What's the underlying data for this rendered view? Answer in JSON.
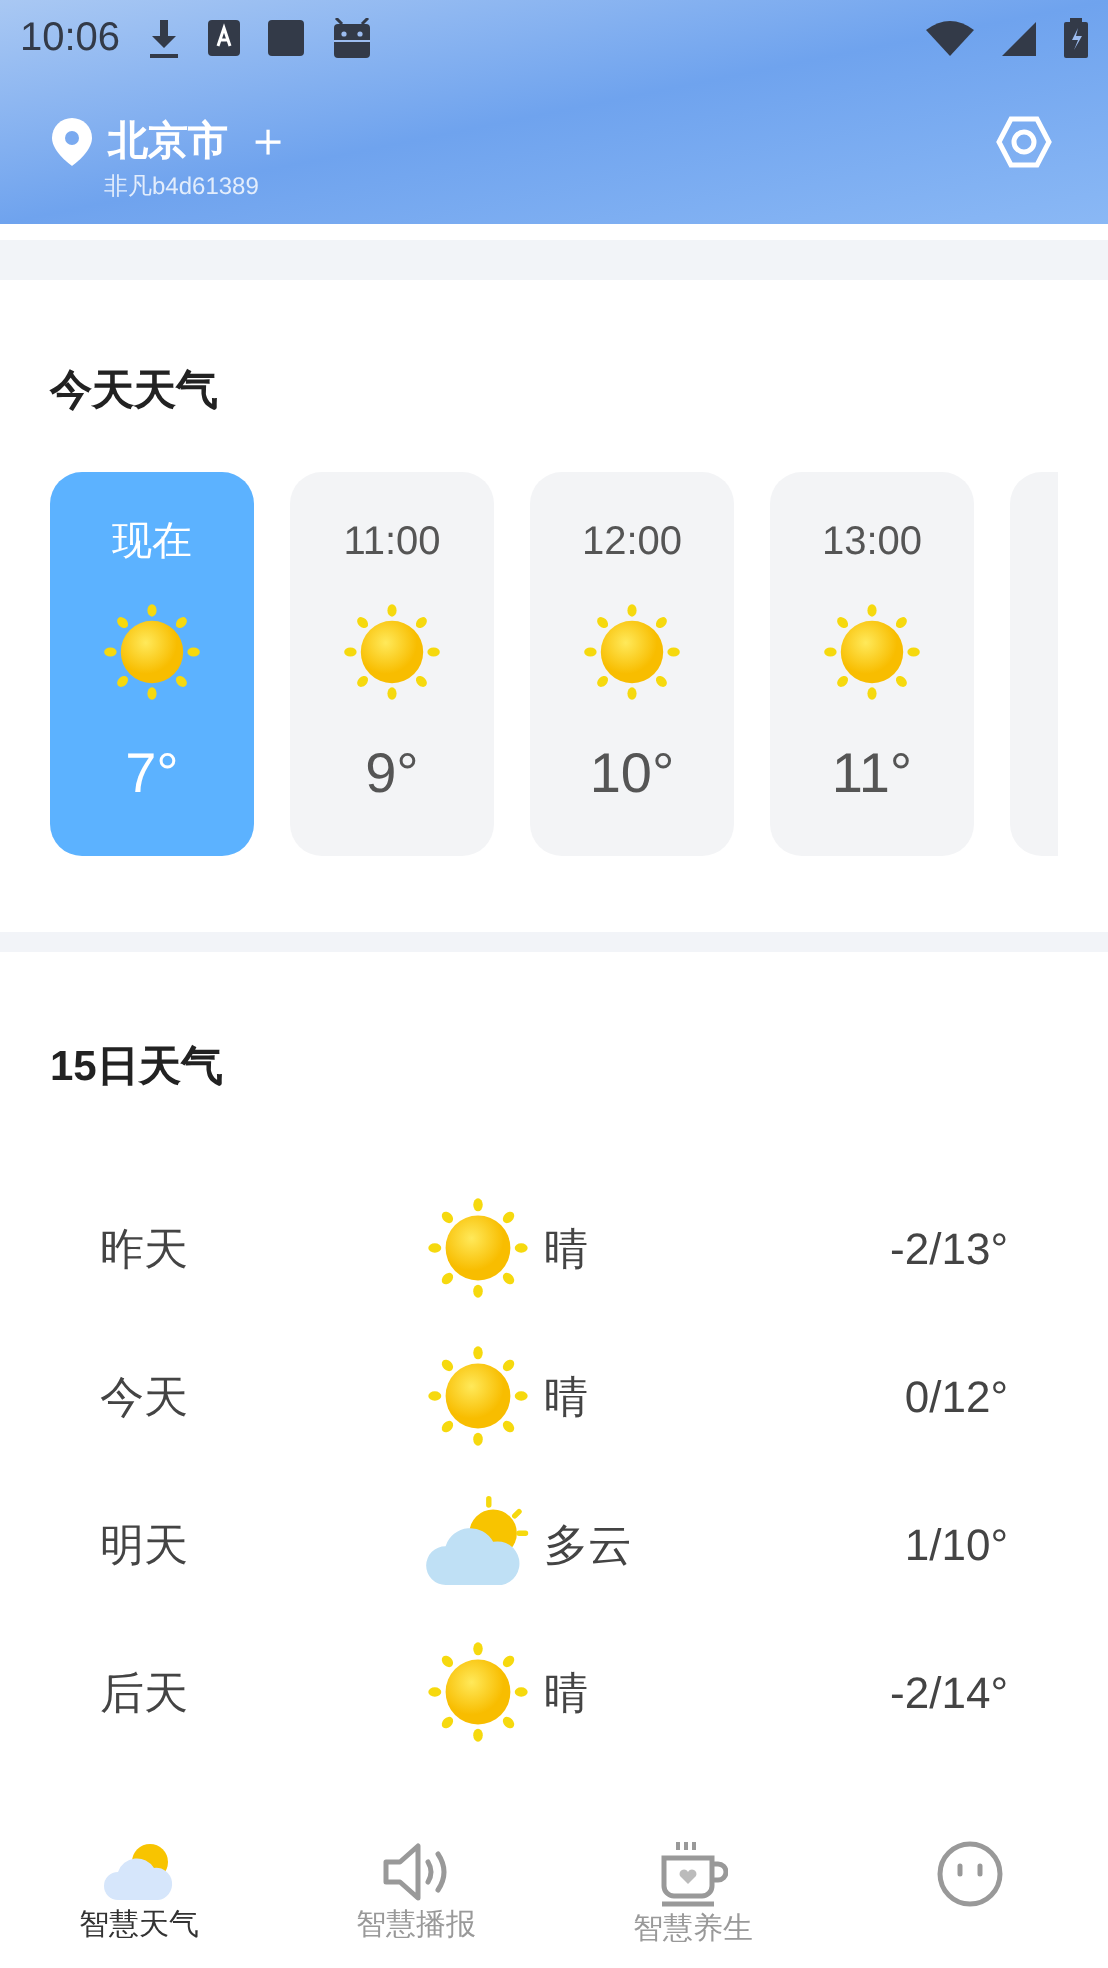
{
  "status_bar": {
    "time": "10:06"
  },
  "header": {
    "city": "北京市",
    "add": "＋",
    "user_id": "非凡b4d61389"
  },
  "hourly": {
    "title": "今天天气",
    "items": [
      {
        "time": "现在",
        "kind": "sunny",
        "temp": "7°",
        "selected": true
      },
      {
        "time": "11:00",
        "kind": "sunny",
        "temp": "9°",
        "selected": false
      },
      {
        "time": "12:00",
        "kind": "sunny",
        "temp": "10°",
        "selected": false
      },
      {
        "time": "13:00",
        "kind": "sunny",
        "temp": "11°",
        "selected": false
      }
    ]
  },
  "daily": {
    "title": "15日天气",
    "rows": [
      {
        "day": "昨天",
        "kind": "sunny",
        "condition": "晴",
        "temps": "-2/13°"
      },
      {
        "day": "今天",
        "kind": "sunny",
        "condition": "晴",
        "temps": "0/12°"
      },
      {
        "day": "明天",
        "kind": "cloudy",
        "condition": "多云",
        "temps": "1/10°"
      },
      {
        "day": "后天",
        "kind": "sunny",
        "condition": "晴",
        "temps": "-2/14°"
      }
    ]
  },
  "tabs": [
    {
      "label": "智慧天气",
      "kind": "weather",
      "selected": true
    },
    {
      "label": "智慧播报",
      "kind": "speaker",
      "selected": false
    },
    {
      "label": "智慧养生",
      "kind": "cup",
      "selected": false
    },
    {
      "kind": "face",
      "selected": false
    }
  ]
}
